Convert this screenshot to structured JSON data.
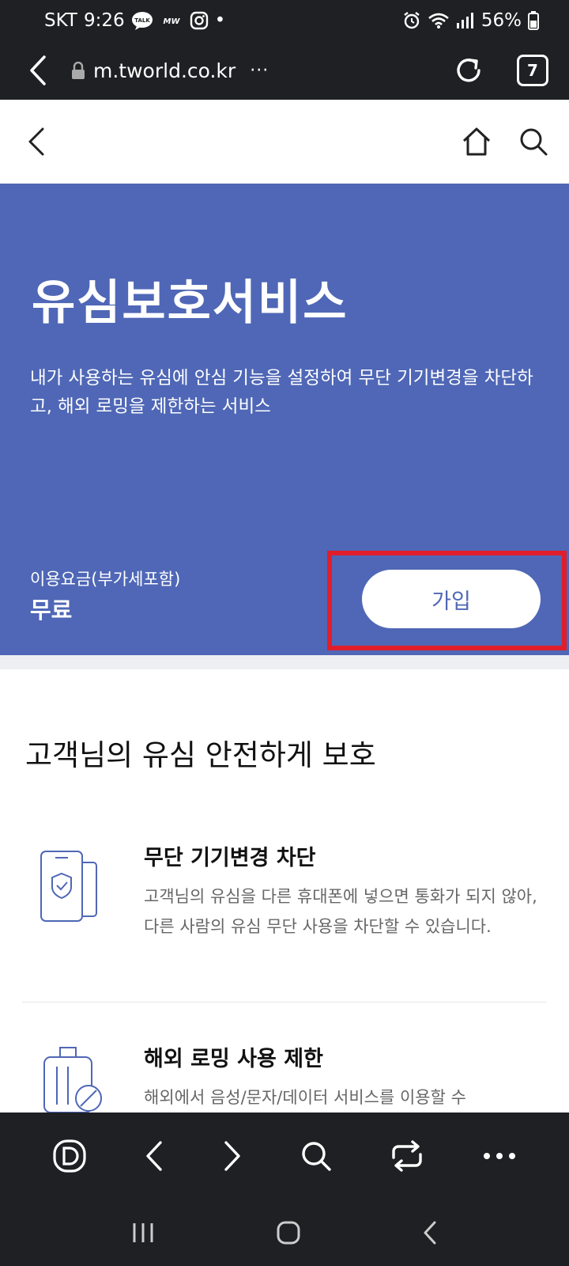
{
  "status_bar": {
    "carrier": "SKT",
    "time": "9:26",
    "talk_badge": "TALK",
    "mw_badge": "MW",
    "dot": "•",
    "battery": "56%"
  },
  "browser": {
    "url": "m.tworld.co.kr",
    "more": "···",
    "tab_count": "7"
  },
  "hero": {
    "title": "유심보호서비스",
    "description": "내가 사용하는 유심에 안심 기능을 설정하여 무단 기기변경을 차단하고, 해외 로밍을 제한하는 서비스",
    "fee_label": "이용요금(부가세포함)",
    "fee_value": "무료",
    "join_label": "가입"
  },
  "content": {
    "section_title": "고객님의 유심 안전하게 보호",
    "features": [
      {
        "title": "무단 기기변경 차단",
        "description": "고객님의 유심을 다른 휴대폰에 넣으면 통화가 되지 않아, 다른 사람의 유심 무단 사용을 차단할 수 있습니다."
      },
      {
        "title": "해외 로밍 사용 제한",
        "description": "해외에서 음성/문자/데이터 서비스를 이용할 수"
      }
    ]
  },
  "colors": {
    "hero_bg": "#4f67b6",
    "highlight": "#e01e2b",
    "system_bar": "#1f2023"
  }
}
